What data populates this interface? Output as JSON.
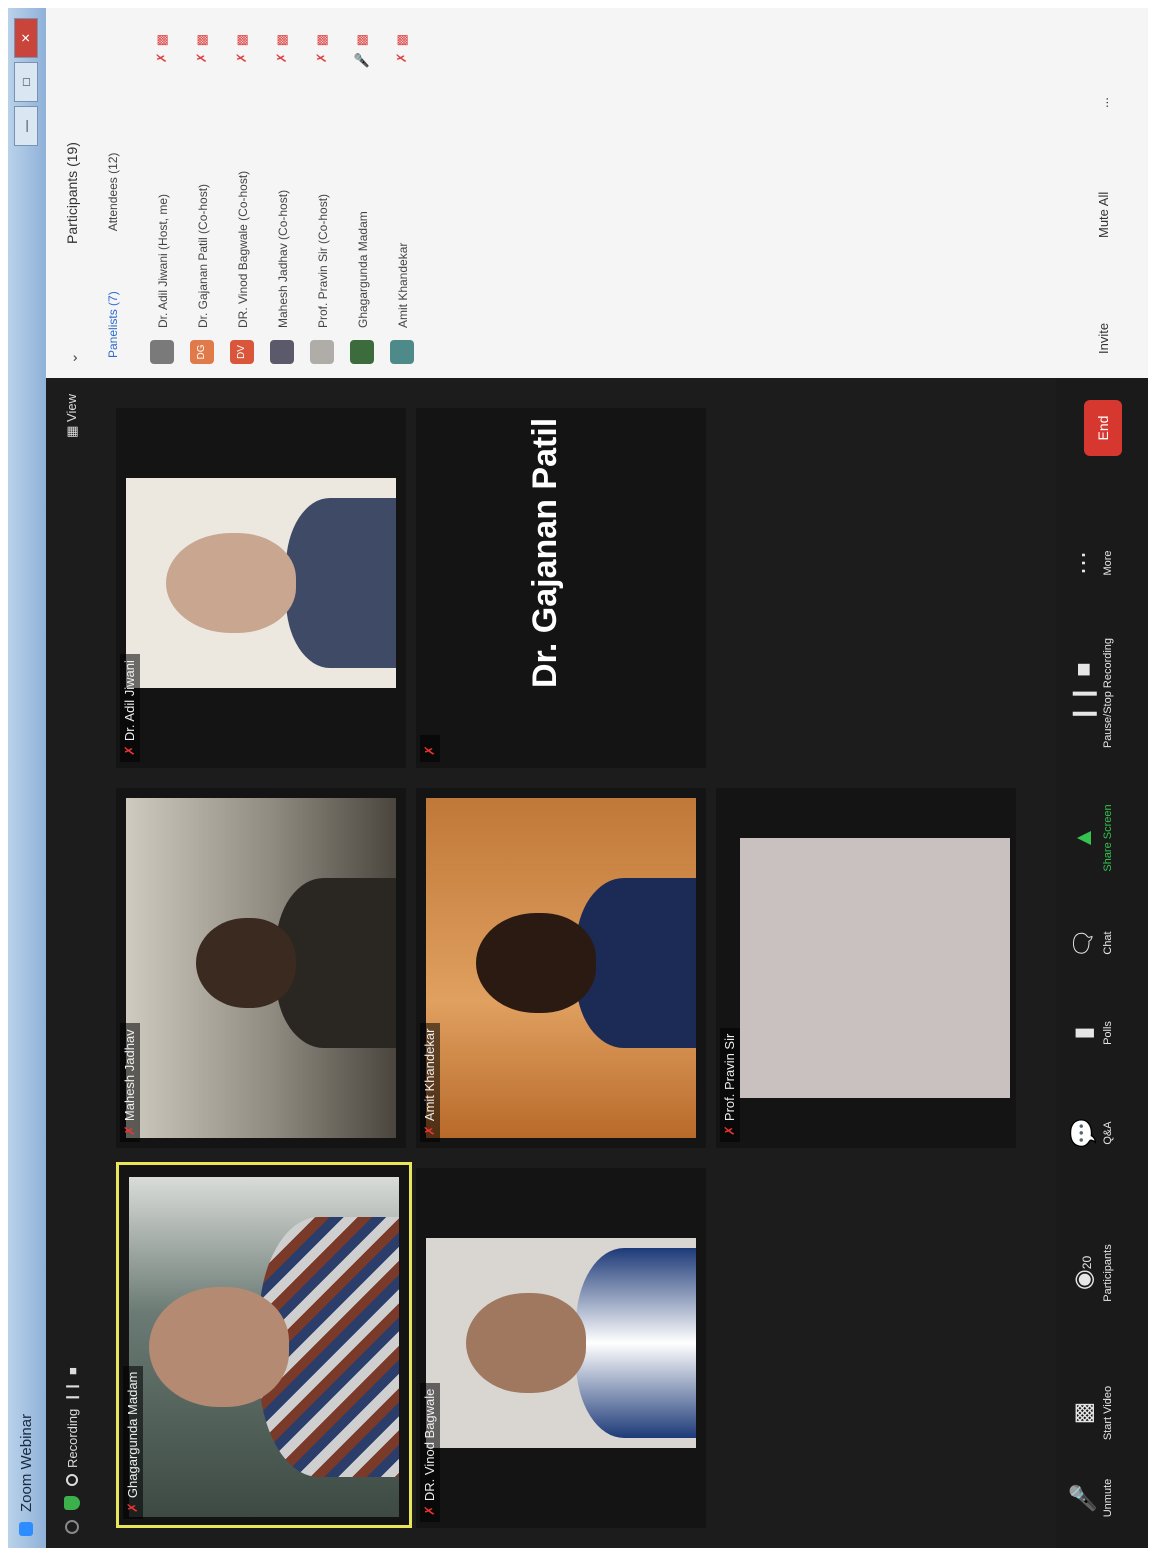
{
  "window": {
    "app_name": "Zoom Webinar",
    "controls": [
      "—",
      "□",
      "✕"
    ]
  },
  "topbar": {
    "recording_label": "Recording",
    "view_label": "View"
  },
  "tiles": [
    {
      "name": "Ghagargunda Madam"
    },
    {
      "name": "Mahesh Jadhav"
    },
    {
      "name": "Dr. Adil Jiwani"
    },
    {
      "name": "DR. Vinod Bagwale"
    },
    {
      "name": "Amit Khandekar"
    },
    {
      "name": ""
    },
    {
      "name": "Prof. Pravin Sir"
    }
  ],
  "active_speaker_card": "Dr. Gajanan Patil",
  "toolbar": {
    "items": [
      {
        "label": "Unmute"
      },
      {
        "label": "Start Video"
      },
      {
        "label": "Participants",
        "count": "20"
      },
      {
        "label": "Q&A"
      },
      {
        "label": "Polls"
      },
      {
        "label": "Chat"
      },
      {
        "label": "Share Screen"
      },
      {
        "label": "Pause/Stop Recording"
      },
      {
        "label": "More"
      }
    ],
    "end_label": "End"
  },
  "panel": {
    "title": "Participants (19)",
    "tabs": [
      {
        "label": "Panelists (7)"
      },
      {
        "label": "Attendees (12)"
      }
    ],
    "participants": [
      {
        "initials": "",
        "name": "Dr. Adil Jiwani (Host, me)",
        "color": "#7a7a7a"
      },
      {
        "initials": "DG",
        "name": "Dr. Gajanan Patil (Co-host)",
        "color": "#e07a4a"
      },
      {
        "initials": "DV",
        "name": "DR. Vinod Bagwale (Co-host)",
        "color": "#d9563b"
      },
      {
        "initials": "",
        "name": "Mahesh Jadhav (Co-host)",
        "color": "#5a5a6a"
      },
      {
        "initials": "",
        "name": "Prof. Pravin Sir (Co-host)",
        "color": "#b0aca8"
      },
      {
        "initials": "",
        "name": "Ghagargunda Madam",
        "color": "#3c6b3c"
      },
      {
        "initials": "",
        "name": "Amit Khandekar",
        "color": "#4e8a8a"
      }
    ],
    "footer": [
      "Invite",
      "Mute All",
      "..."
    ]
  },
  "colors": {
    "selected_tile_border": "#e9e65a",
    "share_screen": "#35c24d",
    "end_button": "#d6372f",
    "muted_icon": "#e33333"
  }
}
